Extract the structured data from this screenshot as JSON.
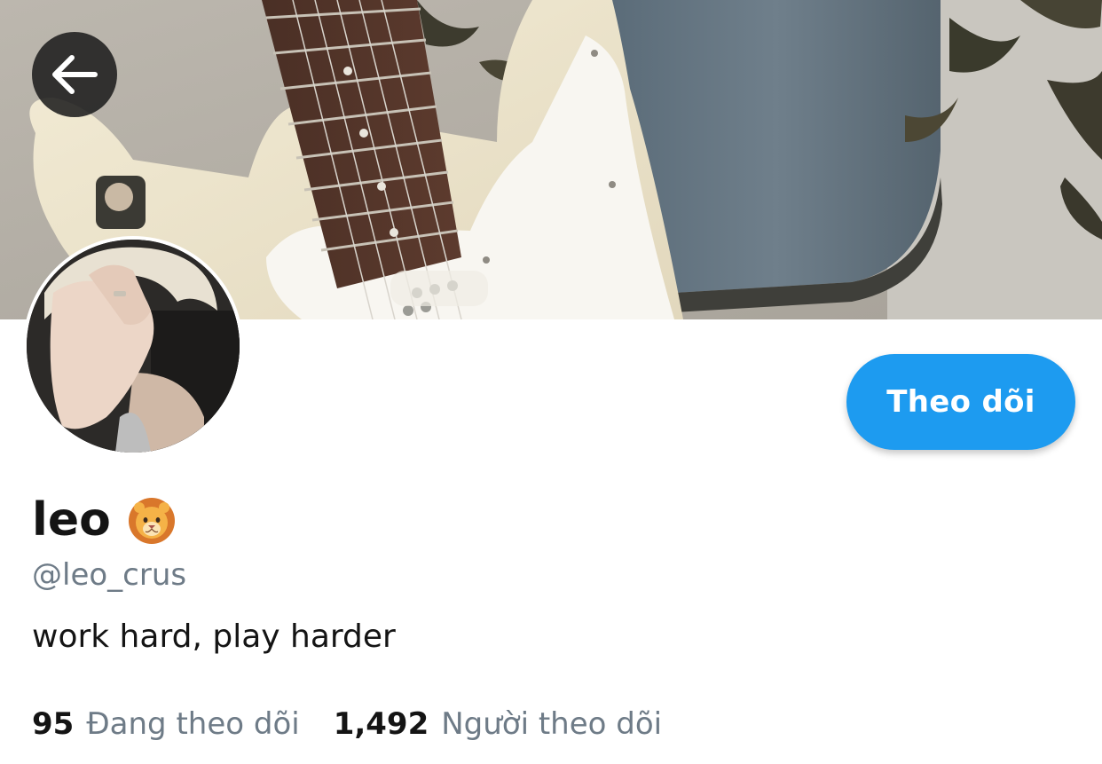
{
  "profile": {
    "display_name": "leo",
    "handle": "@leo_crus",
    "bio": "work hard, play harder",
    "name_emoji_icon": "lion-face-icon"
  },
  "actions": {
    "follow_label": "Theo dõi",
    "back_icon": "arrow-left-icon"
  },
  "stats": {
    "following_count": "95",
    "following_label": "Đang theo dõi",
    "followers_count": "1,492",
    "followers_label": "Người theo dõi"
  },
  "colors": {
    "accent": "#1d9bf0",
    "text_primary": "#141414",
    "text_secondary": "#6e7b87"
  }
}
